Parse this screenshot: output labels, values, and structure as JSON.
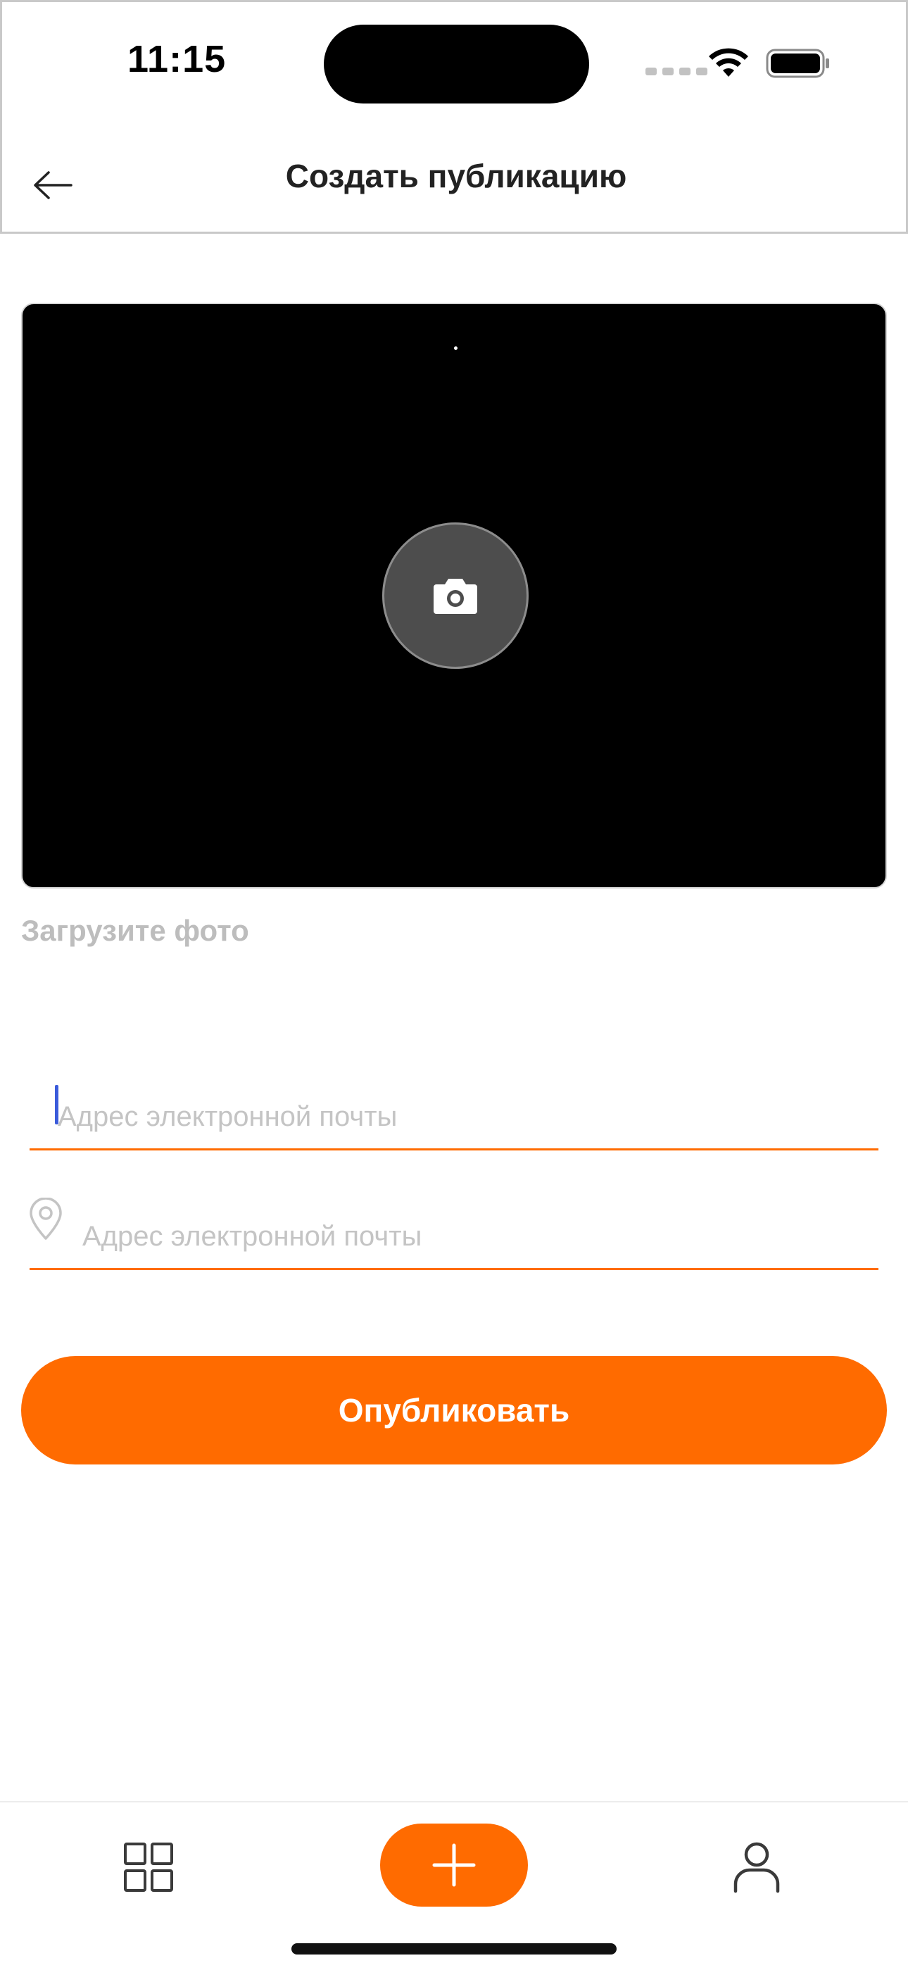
{
  "status_bar": {
    "time": "11:15"
  },
  "header": {
    "title": "Создать публикацию",
    "back_icon": "arrow-left-icon"
  },
  "photo_upload": {
    "icon": "camera-icon",
    "hint": "Загрузите фото"
  },
  "form": {
    "email_placeholder": "Адрес электронной почты",
    "email_value": "",
    "location_placeholder": "Адрес электронной почты",
    "location_value": "",
    "location_icon": "map-pin-icon"
  },
  "publish_button": {
    "label": "Опубликовать"
  },
  "tab_bar": {
    "items": [
      {
        "icon": "grid-icon",
        "active": false
      },
      {
        "icon": "plus-icon",
        "active": true
      },
      {
        "icon": "user-icon",
        "active": false
      }
    ]
  },
  "colors": {
    "accent": "#ff6b00",
    "caret": "#3b5bdb",
    "placeholder": "#c4c4c4",
    "hint": "#bdbdbd"
  }
}
